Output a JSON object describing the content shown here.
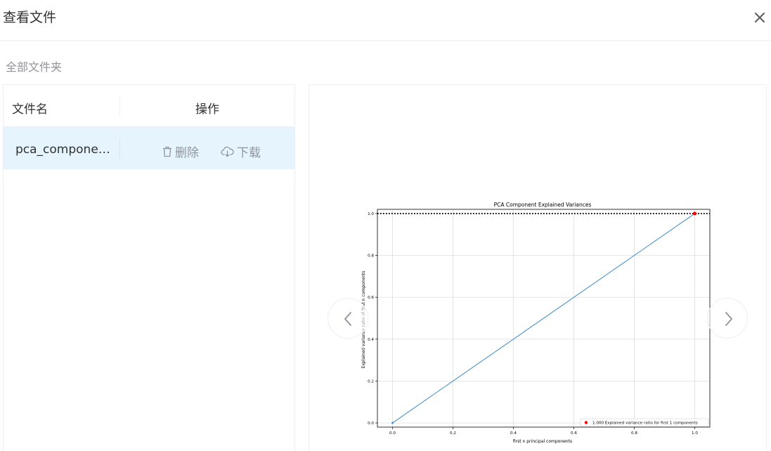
{
  "dialog": {
    "title": "查看文件",
    "close_icon": "close-icon"
  },
  "breadcrumb": {
    "label": "全部文件夹"
  },
  "file_list": {
    "headers": {
      "name": "文件名",
      "actions": "操作"
    },
    "rows": [
      {
        "name": "pca_component...",
        "delete_label": "删除",
        "download_label": "下载"
      }
    ],
    "selected_row_bg": "#e6f5fd"
  },
  "preview": {
    "prev_icon": "chevron-left-icon",
    "next_icon": "chevron-right-icon"
  },
  "chart_data": {
    "type": "line",
    "title": "PCA Component Explained Variances",
    "xlabel": "first n principal components",
    "ylabel": "Explained variance ratio of first n components",
    "xlim": [
      -0.05,
      1.05
    ],
    "ylim": [
      -0.02,
      1.02
    ],
    "xticks": [
      "0.0",
      "0.2",
      "0.4",
      "0.6",
      "0.8",
      "1.0"
    ],
    "yticks": [
      "0.0",
      "0.2",
      "0.4",
      "0.6",
      "0.8",
      "1.0"
    ],
    "grid": true,
    "series": [
      {
        "x": [
          0.0,
          1.0
        ],
        "y": [
          0.0,
          1.0
        ],
        "color": "#3b8bc9"
      }
    ],
    "reference_line": {
      "y": 1.0,
      "style": "dotted",
      "color": "#000000"
    },
    "marker": {
      "x": 1.0,
      "y": 1.0,
      "color": "#ff0000"
    },
    "legend": {
      "placement": "bottom-right",
      "label": "1.000 Explained variance ratio for first 1 components",
      "color": "#ff0000"
    }
  }
}
